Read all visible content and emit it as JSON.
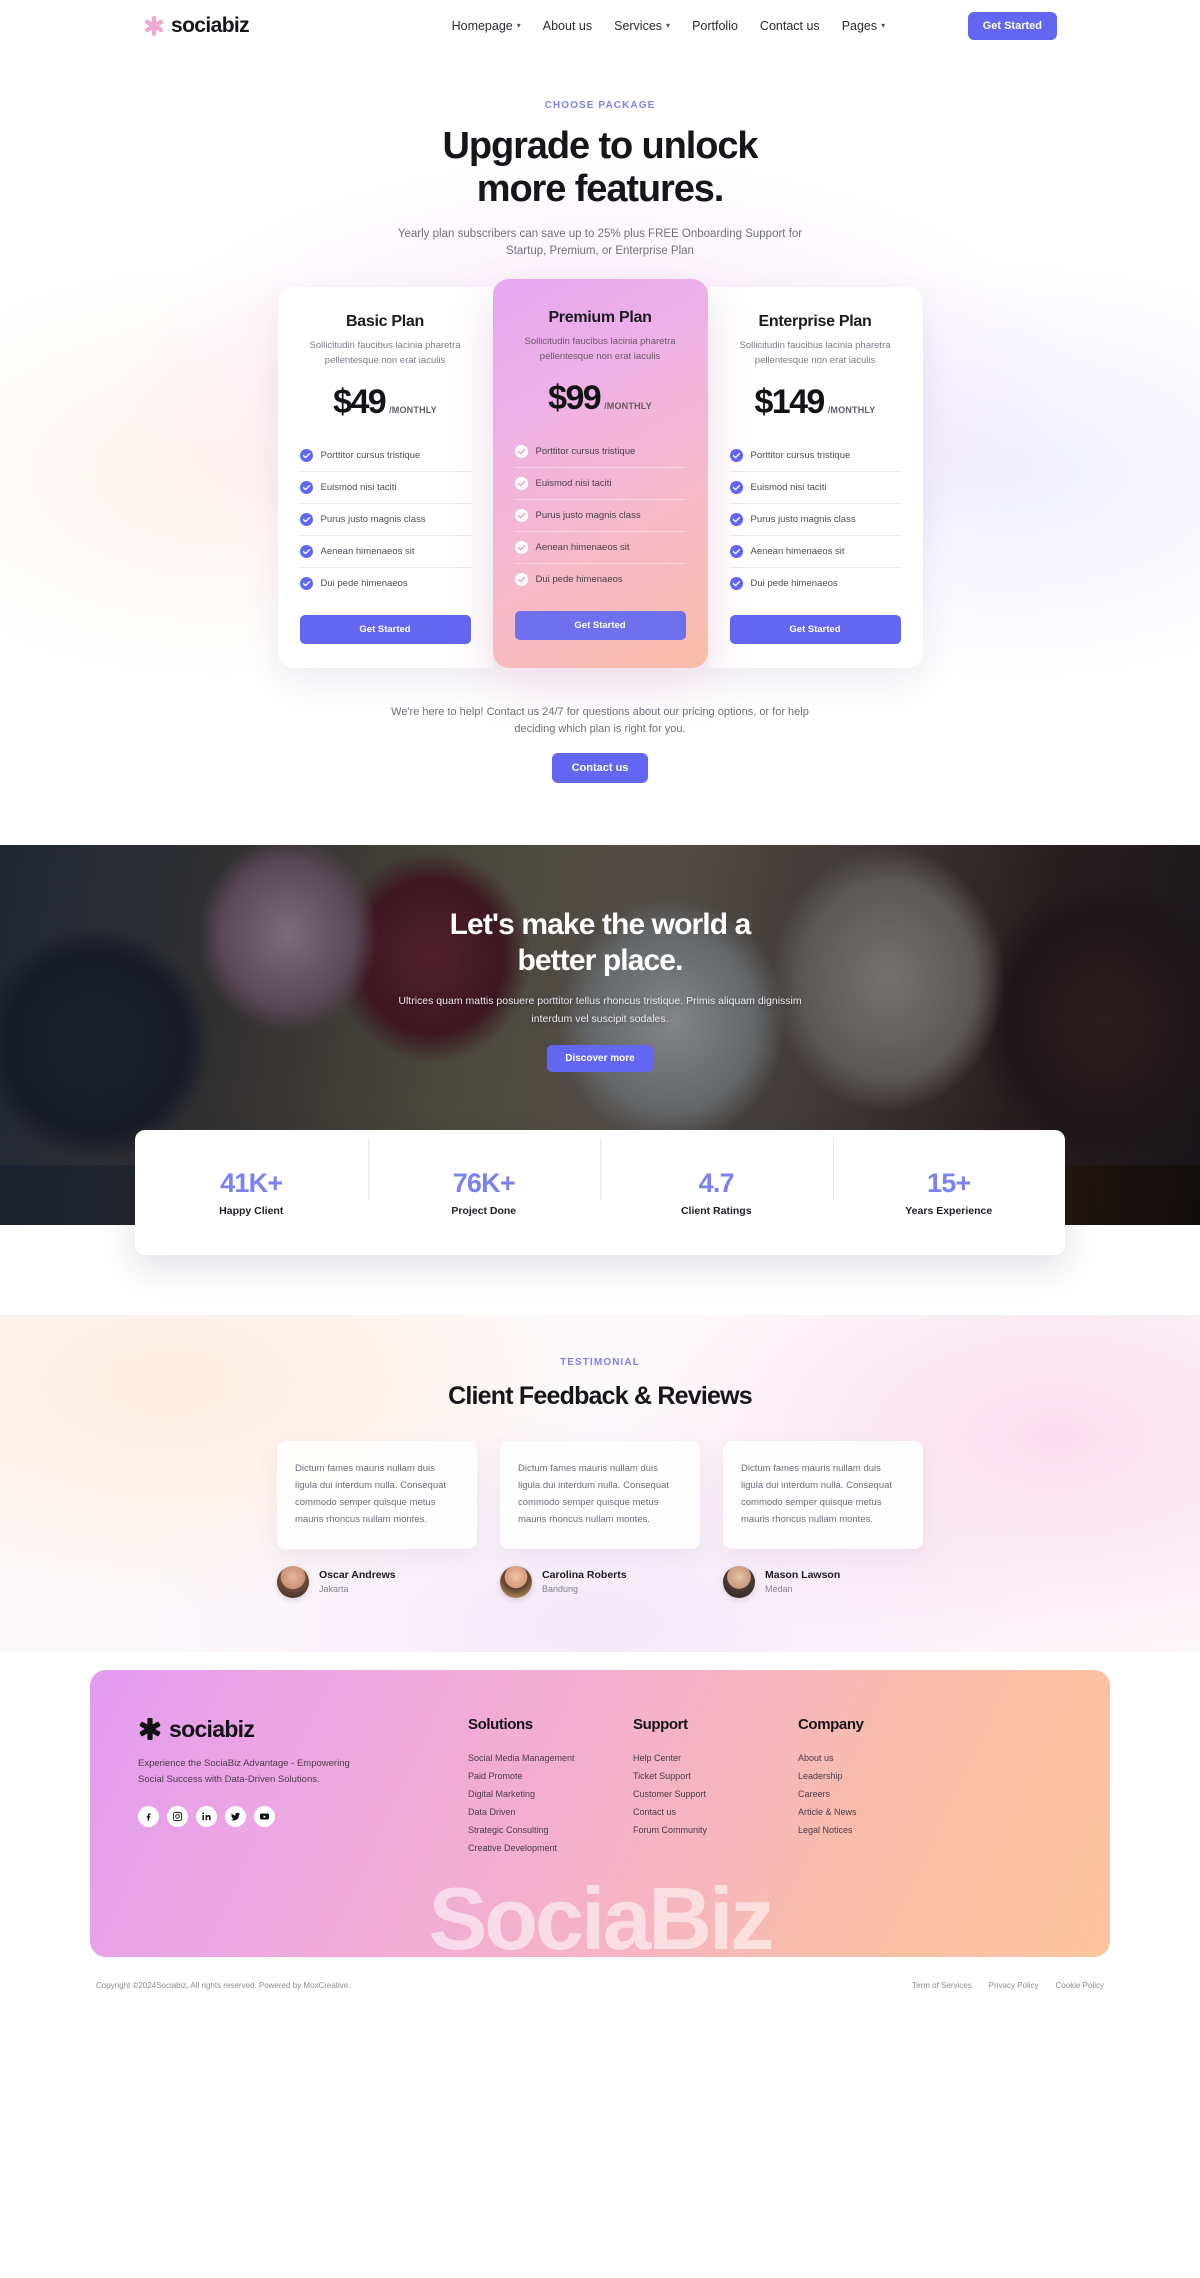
{
  "header": {
    "logo_text": "sociabiz",
    "logo_icon": "asterisk-star-icon",
    "nav": [
      {
        "label": "Homepage",
        "has_caret": true
      },
      {
        "label": "About us",
        "has_caret": false
      },
      {
        "label": "Services",
        "has_caret": true
      },
      {
        "label": "Portfolio",
        "has_caret": false
      },
      {
        "label": "Contact us",
        "has_caret": false
      },
      {
        "label": "Pages",
        "has_caret": true
      }
    ],
    "cta_label": "Get Started"
  },
  "pricing": {
    "eyebrow": "CHOOSE PACKAGE",
    "title_line1": "Upgrade to unlock",
    "title_line2": "more features.",
    "subtitle": "Yearly plan subscribers can save up to 25% plus FREE Onboarding Support for Startup, Premium, or Enterprise Plan",
    "plans": [
      {
        "name": "Basic Plan",
        "desc": "Sollicitudin faucibus lacinia pharetra pellentesque non erat iaculis",
        "price": "$49",
        "period": "/MONTHLY",
        "features": [
          "Porttitor cursus tristique",
          "Euismod nisi taciti",
          "Purus justo magnis class",
          "Aenean himenaeos sit",
          "Dui pede himenaeos"
        ],
        "cta": "Get Started"
      },
      {
        "name": "Premium Plan",
        "desc": "Sollicitudin faucibus lacinia pharetra pellentesque non erat iaculis",
        "price": "$99",
        "period": "/MONTHLY",
        "features": [
          "Porttitor cursus tristique",
          "Euismod nisi taciti",
          "Purus justo magnis class",
          "Aenean himenaeos sit",
          "Dui pede himenaeos"
        ],
        "cta": "Get Started"
      },
      {
        "name": "Enterprise Plan",
        "desc": "Sollicitudin faucibus lacinia pharetra pellentesque non erat iaculis",
        "price": "$149",
        "period": "/MONTHLY",
        "features": [
          "Porttitor cursus tristique",
          "Euismod nisi taciti",
          "Purus justo magnis class",
          "Aenean himenaeos sit",
          "Dui pede himenaeos"
        ],
        "cta": "Get Started"
      }
    ],
    "help_text": "We're here to help! Contact us 24/7 for questions about our pricing options, or for help deciding which plan is right for you.",
    "contact_label": "Contact us"
  },
  "banner": {
    "title_line1": "Let's make the world a",
    "title_line2": "better place.",
    "subtitle": "Ultrices quam mattis posuere porttitor tellus rhoncus tristique. Primis aliquam dignissim interdum vel suscipit sodales.",
    "cta_label": "Discover more"
  },
  "stats": [
    {
      "value": "41K+",
      "label": "Happy Client"
    },
    {
      "value": "76K+",
      "label": "Project Done"
    },
    {
      "value": "4.7",
      "label": "Client Ratings"
    },
    {
      "value": "15+",
      "label": "Years Experience"
    }
  ],
  "testimonial": {
    "eyebrow": "TESTIMONIAL",
    "title": "Client Feedback & Reviews",
    "cards": [
      {
        "quote": "Dictum fames mauris nullam duis ligula dui interdum nulla. Consequat commodo semper quisque metus mauris rhoncus nullam montes.",
        "name": "Oscar Andrews",
        "city": "Jakarta"
      },
      {
        "quote": "Dictum fames mauris nullam duis ligula dui interdum nulla. Consequat commodo semper quisque metus mauris rhoncus nullam montes.",
        "name": "Carolina Roberts",
        "city": "Bandung"
      },
      {
        "quote": "Dictum fames mauris nullam duis ligula dui interdum nulla. Consequat commodo semper quisque metus mauris rhoncus nullam montes.",
        "name": "Mason Lawson",
        "city": "Medan"
      }
    ]
  },
  "footer": {
    "logo_text": "sociabiz",
    "tagline": "Experience the SociaBiz Advantage - Empowering Social Success with Data-Driven Solutions.",
    "socials": [
      "facebook-icon",
      "instagram-icon",
      "linkedin-icon",
      "twitter-icon",
      "youtube-icon"
    ],
    "columns": [
      {
        "title": "Solutions",
        "links": [
          "Social Media Management",
          "Paid Promote",
          "Digital Marketing",
          "Data Driven",
          "Strategic Consulting",
          "Creative Development"
        ]
      },
      {
        "title": "Support",
        "links": [
          "Help Center",
          "Ticket Support",
          "Customer Support",
          "Contact us",
          "Forum Community"
        ]
      },
      {
        "title": "Company",
        "links": [
          "About us",
          "Leadership",
          "Careers",
          "Article & News",
          "Legal Notices"
        ]
      }
    ],
    "watermark": "SociaBiz",
    "copyright": "Copyright ©2024Sociabiz, All rights reserved. Powered by MoxCreative.",
    "legal_links": [
      "Term of Services",
      "Privacy Policy",
      "Cookie Policy"
    ]
  },
  "colors": {
    "accent": "#6366f1",
    "stat_number": "#7b82f0",
    "eyebrow": "#7b82f0"
  }
}
